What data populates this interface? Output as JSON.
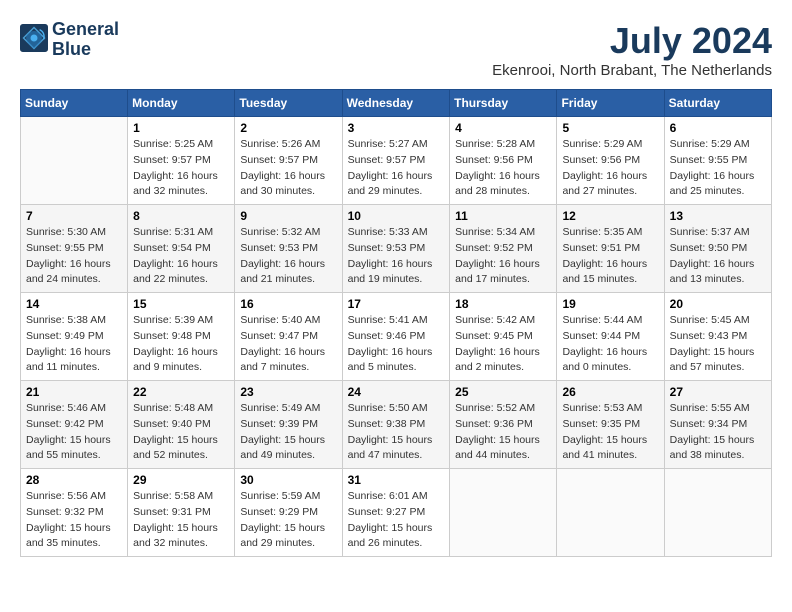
{
  "header": {
    "logo_line1": "General",
    "logo_line2": "Blue",
    "title": "July 2024",
    "subtitle": "Ekenrooi, North Brabant, The Netherlands"
  },
  "calendar": {
    "days_of_week": [
      "Sunday",
      "Monday",
      "Tuesday",
      "Wednesday",
      "Thursday",
      "Friday",
      "Saturday"
    ],
    "weeks": [
      [
        {
          "day": "",
          "info": ""
        },
        {
          "day": "1",
          "info": "Sunrise: 5:25 AM\nSunset: 9:57 PM\nDaylight: 16 hours\nand 32 minutes."
        },
        {
          "day": "2",
          "info": "Sunrise: 5:26 AM\nSunset: 9:57 PM\nDaylight: 16 hours\nand 30 minutes."
        },
        {
          "day": "3",
          "info": "Sunrise: 5:27 AM\nSunset: 9:57 PM\nDaylight: 16 hours\nand 29 minutes."
        },
        {
          "day": "4",
          "info": "Sunrise: 5:28 AM\nSunset: 9:56 PM\nDaylight: 16 hours\nand 28 minutes."
        },
        {
          "day": "5",
          "info": "Sunrise: 5:29 AM\nSunset: 9:56 PM\nDaylight: 16 hours\nand 27 minutes."
        },
        {
          "day": "6",
          "info": "Sunrise: 5:29 AM\nSunset: 9:55 PM\nDaylight: 16 hours\nand 25 minutes."
        }
      ],
      [
        {
          "day": "7",
          "info": "Sunrise: 5:30 AM\nSunset: 9:55 PM\nDaylight: 16 hours\nand 24 minutes."
        },
        {
          "day": "8",
          "info": "Sunrise: 5:31 AM\nSunset: 9:54 PM\nDaylight: 16 hours\nand 22 minutes."
        },
        {
          "day": "9",
          "info": "Sunrise: 5:32 AM\nSunset: 9:53 PM\nDaylight: 16 hours\nand 21 minutes."
        },
        {
          "day": "10",
          "info": "Sunrise: 5:33 AM\nSunset: 9:53 PM\nDaylight: 16 hours\nand 19 minutes."
        },
        {
          "day": "11",
          "info": "Sunrise: 5:34 AM\nSunset: 9:52 PM\nDaylight: 16 hours\nand 17 minutes."
        },
        {
          "day": "12",
          "info": "Sunrise: 5:35 AM\nSunset: 9:51 PM\nDaylight: 16 hours\nand 15 minutes."
        },
        {
          "day": "13",
          "info": "Sunrise: 5:37 AM\nSunset: 9:50 PM\nDaylight: 16 hours\nand 13 minutes."
        }
      ],
      [
        {
          "day": "14",
          "info": "Sunrise: 5:38 AM\nSunset: 9:49 PM\nDaylight: 16 hours\nand 11 minutes."
        },
        {
          "day": "15",
          "info": "Sunrise: 5:39 AM\nSunset: 9:48 PM\nDaylight: 16 hours\nand 9 minutes."
        },
        {
          "day": "16",
          "info": "Sunrise: 5:40 AM\nSunset: 9:47 PM\nDaylight: 16 hours\nand 7 minutes."
        },
        {
          "day": "17",
          "info": "Sunrise: 5:41 AM\nSunset: 9:46 PM\nDaylight: 16 hours\nand 5 minutes."
        },
        {
          "day": "18",
          "info": "Sunrise: 5:42 AM\nSunset: 9:45 PM\nDaylight: 16 hours\nand 2 minutes."
        },
        {
          "day": "19",
          "info": "Sunrise: 5:44 AM\nSunset: 9:44 PM\nDaylight: 16 hours\nand 0 minutes."
        },
        {
          "day": "20",
          "info": "Sunrise: 5:45 AM\nSunset: 9:43 PM\nDaylight: 15 hours\nand 57 minutes."
        }
      ],
      [
        {
          "day": "21",
          "info": "Sunrise: 5:46 AM\nSunset: 9:42 PM\nDaylight: 15 hours\nand 55 minutes."
        },
        {
          "day": "22",
          "info": "Sunrise: 5:48 AM\nSunset: 9:40 PM\nDaylight: 15 hours\nand 52 minutes."
        },
        {
          "day": "23",
          "info": "Sunrise: 5:49 AM\nSunset: 9:39 PM\nDaylight: 15 hours\nand 49 minutes."
        },
        {
          "day": "24",
          "info": "Sunrise: 5:50 AM\nSunset: 9:38 PM\nDaylight: 15 hours\nand 47 minutes."
        },
        {
          "day": "25",
          "info": "Sunrise: 5:52 AM\nSunset: 9:36 PM\nDaylight: 15 hours\nand 44 minutes."
        },
        {
          "day": "26",
          "info": "Sunrise: 5:53 AM\nSunset: 9:35 PM\nDaylight: 15 hours\nand 41 minutes."
        },
        {
          "day": "27",
          "info": "Sunrise: 5:55 AM\nSunset: 9:34 PM\nDaylight: 15 hours\nand 38 minutes."
        }
      ],
      [
        {
          "day": "28",
          "info": "Sunrise: 5:56 AM\nSunset: 9:32 PM\nDaylight: 15 hours\nand 35 minutes."
        },
        {
          "day": "29",
          "info": "Sunrise: 5:58 AM\nSunset: 9:31 PM\nDaylight: 15 hours\nand 32 minutes."
        },
        {
          "day": "30",
          "info": "Sunrise: 5:59 AM\nSunset: 9:29 PM\nDaylight: 15 hours\nand 29 minutes."
        },
        {
          "day": "31",
          "info": "Sunrise: 6:01 AM\nSunset: 9:27 PM\nDaylight: 15 hours\nand 26 minutes."
        },
        {
          "day": "",
          "info": ""
        },
        {
          "day": "",
          "info": ""
        },
        {
          "day": "",
          "info": ""
        }
      ]
    ]
  }
}
